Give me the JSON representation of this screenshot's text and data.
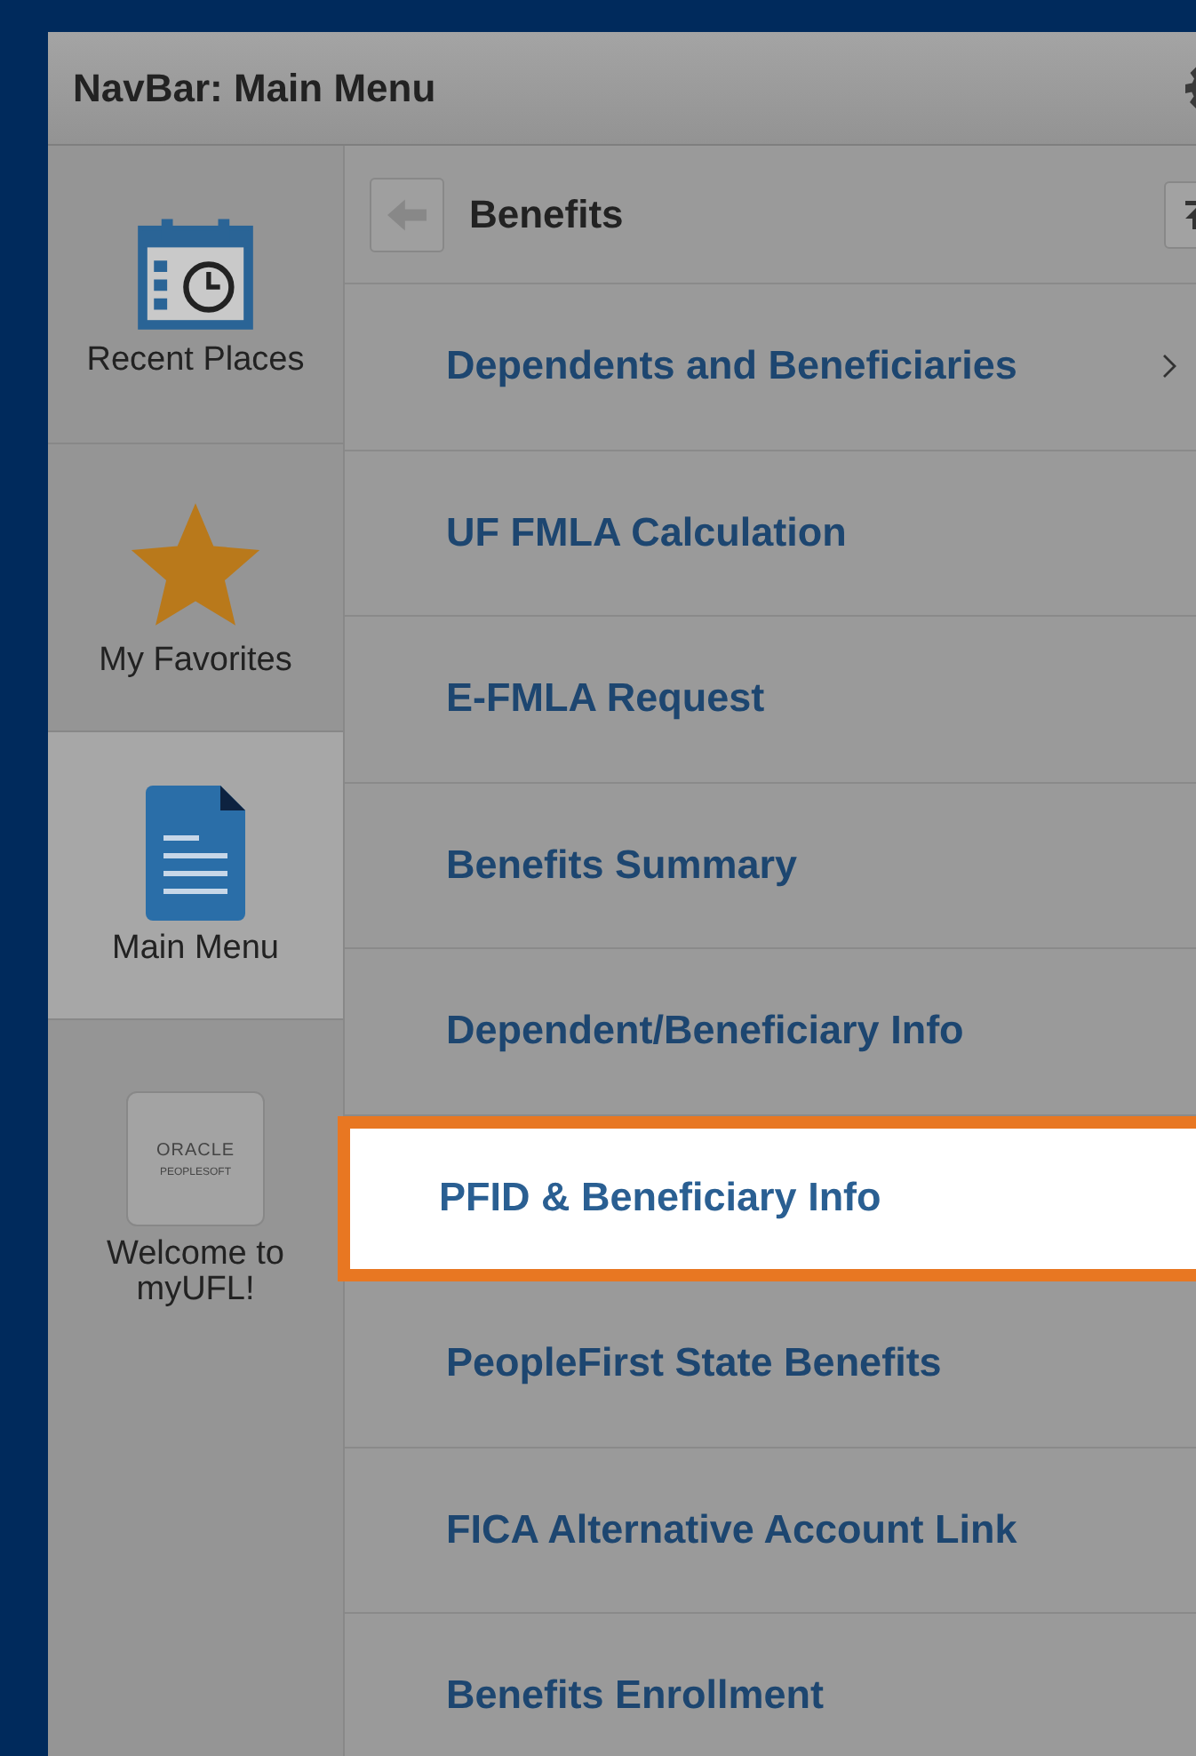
{
  "navbar": {
    "title": "NavBar: Main Menu"
  },
  "sidebar": {
    "items": [
      {
        "label": "Recent Places",
        "kind": "calendar",
        "selected": false
      },
      {
        "label": "My Favorites",
        "kind": "star",
        "selected": false
      },
      {
        "label": "Main Menu",
        "kind": "document",
        "selected": true
      },
      {
        "label": "Welcome to myUFL!",
        "kind": "logo",
        "logo_lines": [
          "ORACLE",
          "PEOPLESOFT"
        ],
        "selected": false
      }
    ]
  },
  "menu": {
    "title": "Benefits",
    "items": [
      {
        "label": "Dependents and Beneficiaries",
        "has_submenu": true,
        "highlighted": false
      },
      {
        "label": "UF FMLA Calculation",
        "has_submenu": false,
        "highlighted": false
      },
      {
        "label": "E-FMLA Request",
        "has_submenu": false,
        "highlighted": false
      },
      {
        "label": "Benefits Summary",
        "has_submenu": false,
        "highlighted": false
      },
      {
        "label": "Dependent/Beneficiary Info",
        "has_submenu": false,
        "highlighted": false
      },
      {
        "label": "PFID & Beneficiary Info",
        "has_submenu": false,
        "highlighted": true
      },
      {
        "label": "PeopleFirst State Benefits",
        "has_submenu": false,
        "highlighted": false
      },
      {
        "label": "FICA Alternative Account Link",
        "has_submenu": false,
        "highlighted": false
      },
      {
        "label": "Benefits Enrollment",
        "has_submenu": false,
        "highlighted": false
      }
    ]
  }
}
